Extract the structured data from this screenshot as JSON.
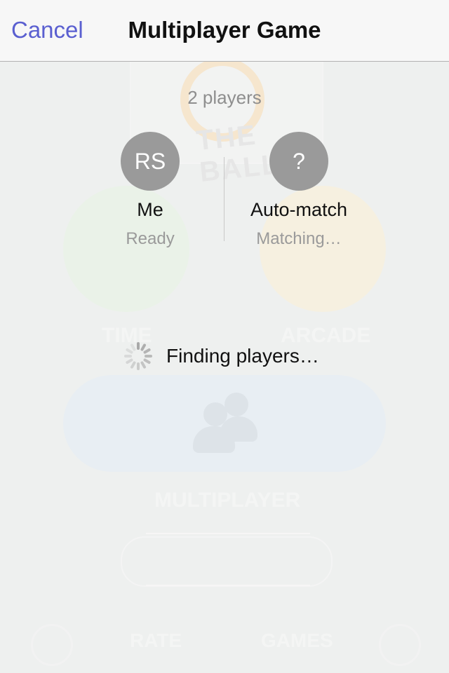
{
  "nav": {
    "cancel_label": "Cancel",
    "title": "Multiplayer Game"
  },
  "lobby": {
    "player_count": "2 players",
    "players": [
      {
        "initials": "RS",
        "name": "Me",
        "status": "Ready"
      },
      {
        "initials": "?",
        "name": "Auto-match",
        "status": "Matching…"
      }
    ],
    "finding_text": "Finding players…"
  },
  "background_menu": {
    "logo_text": "THE BALL",
    "time_label": "TIME",
    "arcade_label": "ARCADE",
    "multiplayer_label": "MULTIPLAYER",
    "rate_label": "RATE",
    "games_label": "GAMES"
  },
  "colors": {
    "accent": "#5a5fd0",
    "avatar_bg": "#9a9a9a",
    "background": "#eef0ef"
  }
}
